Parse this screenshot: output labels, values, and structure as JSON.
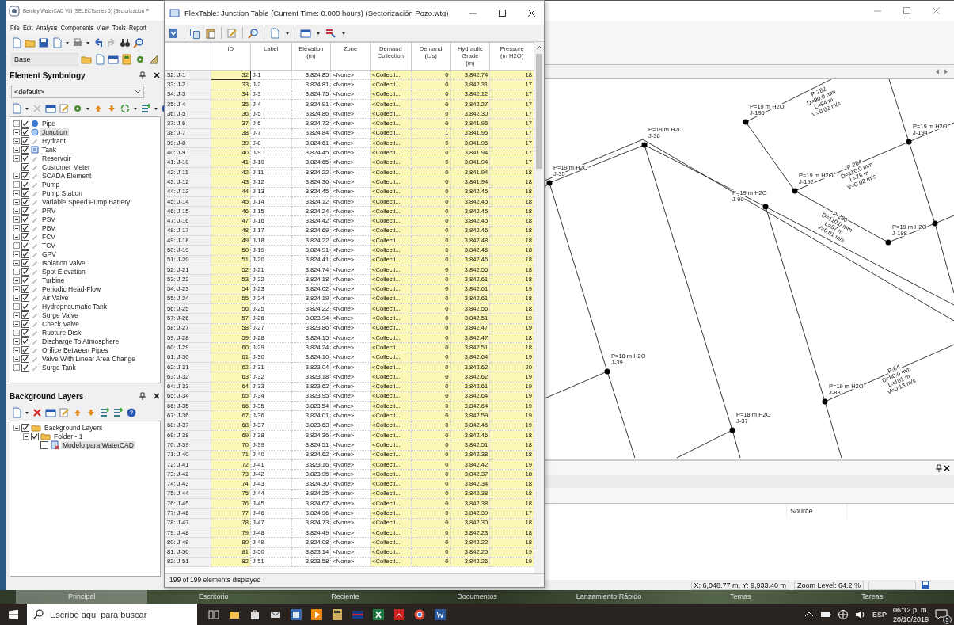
{
  "main_window": {
    "title": "Bentley WaterCAD V8i (SELECTseries 5) [Sectorización P"
  },
  "menu": [
    "File",
    "Edit",
    "Analysis",
    "Components",
    "View",
    "Tools",
    "Report"
  ],
  "scenario_dropdown": {
    "value": "Base"
  },
  "element_symbology": {
    "title": "Element Symbology",
    "dropdown": {
      "value": "<default>"
    },
    "items": [
      {
        "label": "Pipe",
        "kind": "pipe",
        "checked": true,
        "expandable": true,
        "selected": false
      },
      {
        "label": "Junction",
        "kind": "junction",
        "checked": true,
        "expandable": true,
        "selected": true
      },
      {
        "label": "Hydrant",
        "kind": "generic",
        "checked": true,
        "expandable": true,
        "selected": false
      },
      {
        "label": "Tank",
        "kind": "tank",
        "checked": true,
        "expandable": true,
        "selected": false
      },
      {
        "label": "Reservoir",
        "kind": "generic",
        "checked": true,
        "expandable": true,
        "selected": false
      },
      {
        "label": "Customer Meter",
        "kind": "generic",
        "checked": true,
        "expandable": false,
        "selected": false
      },
      {
        "label": "SCADA Element",
        "kind": "generic",
        "checked": true,
        "expandable": true,
        "selected": false
      },
      {
        "label": "Pump",
        "kind": "generic",
        "checked": true,
        "expandable": true,
        "selected": false
      },
      {
        "label": "Pump Station",
        "kind": "generic",
        "checked": true,
        "expandable": true,
        "selected": false
      },
      {
        "label": "Variable Speed Pump Battery",
        "kind": "generic",
        "checked": true,
        "expandable": true,
        "selected": false
      },
      {
        "label": "PRV",
        "kind": "generic",
        "checked": true,
        "expandable": true,
        "selected": false
      },
      {
        "label": "PSV",
        "kind": "generic",
        "checked": true,
        "expandable": true,
        "selected": false
      },
      {
        "label": "PBV",
        "kind": "generic",
        "checked": true,
        "expandable": true,
        "selected": false
      },
      {
        "label": "FCV",
        "kind": "generic",
        "checked": true,
        "expandable": true,
        "selected": false
      },
      {
        "label": "TCV",
        "kind": "generic",
        "checked": true,
        "expandable": true,
        "selected": false
      },
      {
        "label": "GPV",
        "kind": "generic",
        "checked": true,
        "expandable": true,
        "selected": false
      },
      {
        "label": "Isolation Valve",
        "kind": "generic",
        "checked": true,
        "expandable": true,
        "selected": false
      },
      {
        "label": "Spot Elevation",
        "kind": "generic",
        "checked": true,
        "expandable": true,
        "selected": false
      },
      {
        "label": "Turbine",
        "kind": "generic",
        "checked": true,
        "expandable": true,
        "selected": false
      },
      {
        "label": "Periodic Head-Flow",
        "kind": "generic",
        "checked": true,
        "expandable": true,
        "selected": false
      },
      {
        "label": "Air Valve",
        "kind": "generic",
        "checked": true,
        "expandable": true,
        "selected": false
      },
      {
        "label": "Hydropneumatic Tank",
        "kind": "generic",
        "checked": true,
        "expandable": true,
        "selected": false
      },
      {
        "label": "Surge Valve",
        "kind": "generic",
        "checked": true,
        "expandable": true,
        "selected": false
      },
      {
        "label": "Check Valve",
        "kind": "generic",
        "checked": true,
        "expandable": true,
        "selected": false
      },
      {
        "label": "Rupture Disk",
        "kind": "generic",
        "checked": true,
        "expandable": true,
        "selected": false
      },
      {
        "label": "Discharge To Atmosphere",
        "kind": "generic",
        "checked": true,
        "expandable": true,
        "selected": false
      },
      {
        "label": "Orifice Between Pipes",
        "kind": "generic",
        "checked": true,
        "expandable": true,
        "selected": false
      },
      {
        "label": "Valve With Linear Area Change",
        "kind": "generic",
        "checked": true,
        "expandable": true,
        "selected": false
      },
      {
        "label": "Surge Tank",
        "kind": "generic",
        "checked": true,
        "expandable": true,
        "selected": false
      }
    ]
  },
  "background_layers": {
    "title": "Background Layers",
    "tree": [
      {
        "label": "Background Layers",
        "kind": "folder",
        "checked": true,
        "selected": false,
        "children": [
          {
            "label": "Folder - 1",
            "kind": "folder",
            "checked": true,
            "selected": false,
            "children": [
              {
                "label": "Modelo para WaterCAD",
                "kind": "file",
                "checked": false,
                "selected": true
              }
            ]
          }
        ]
      }
    ]
  },
  "flextable": {
    "title": "FlexTable: Junction Table (Current Time:  0.000 hours) (Sectorización Pozo.wtg)",
    "columns": [
      {
        "label": "ID",
        "readonly": true
      },
      {
        "label": "Label",
        "readonly": false
      },
      {
        "label": "Elevation\n(m)",
        "readonly": false
      },
      {
        "label": "Zone",
        "readonly": false
      },
      {
        "label": "Demand\nCollection",
        "readonly": true
      },
      {
        "label": "Demand\n(L/s)",
        "readonly": true
      },
      {
        "label": "Hydraulic\nGrade\n(m)",
        "readonly": true
      },
      {
        "label": "Pressure\n(m H2O)",
        "readonly": true
      }
    ],
    "rows": [
      {
        "name": "32: J-1",
        "selected": true,
        "cells": [
          "32",
          "J-1",
          "3,824.85",
          "<None>",
          "<Collecti...",
          "0",
          "3,842.74",
          "18"
        ]
      },
      {
        "name": "33: J-2",
        "selected": false,
        "cells": [
          "33",
          "J-2",
          "3,824.81",
          "<None>",
          "<Collecti...",
          "0",
          "3,842.31",
          "17"
        ]
      },
      {
        "name": "34: J-3",
        "selected": false,
        "cells": [
          "34",
          "J-3",
          "3,824.75",
          "<None>",
          "<Collecti...",
          "0",
          "3,842.12",
          "17"
        ]
      },
      {
        "name": "35: J-4",
        "selected": false,
        "cells": [
          "35",
          "J-4",
          "3,824.91",
          "<None>",
          "<Collecti...",
          "0",
          "3,842.27",
          "17"
        ]
      },
      {
        "name": "36: J-5",
        "selected": false,
        "cells": [
          "36",
          "J-5",
          "3,824.86",
          "<None>",
          "<Collecti...",
          "0",
          "3,842.30",
          "17"
        ]
      },
      {
        "name": "37: J-6",
        "selected": false,
        "cells": [
          "37",
          "J-6",
          "3,824.72",
          "<None>",
          "<Collecti...",
          "0",
          "3,841.95",
          "17"
        ]
      },
      {
        "name": "38: J-7",
        "selected": false,
        "cells": [
          "38",
          "J-7",
          "3,824.84",
          "<None>",
          "<Collecti...",
          "1",
          "3,841.95",
          "17"
        ]
      },
      {
        "name": "39: J-8",
        "selected": false,
        "cells": [
          "39",
          "J-8",
          "3,824.61",
          "<None>",
          "<Collecti...",
          "0",
          "3,841.96",
          "17"
        ]
      },
      {
        "name": "40: J-9",
        "selected": false,
        "cells": [
          "40",
          "J-9",
          "3,824.45",
          "<None>",
          "<Collecti...",
          "0",
          "3,841.94",
          "17"
        ]
      },
      {
        "name": "41: J-10",
        "selected": false,
        "cells": [
          "41",
          "J-10",
          "3,824.65",
          "<None>",
          "<Collecti...",
          "0",
          "3,841.94",
          "17"
        ]
      },
      {
        "name": "42: J-11",
        "selected": false,
        "cells": [
          "42",
          "J-11",
          "3,824.22",
          "<None>",
          "<Collecti...",
          "0",
          "3,841.94",
          "18"
        ]
      },
      {
        "name": "43: J-12",
        "selected": false,
        "cells": [
          "43",
          "J-12",
          "3,824.36",
          "<None>",
          "<Collecti...",
          "0",
          "3,841.94",
          "18"
        ]
      },
      {
        "name": "44: J-13",
        "selected": false,
        "cells": [
          "44",
          "J-13",
          "3,824.45",
          "<None>",
          "<Collecti...",
          "0",
          "3,842.45",
          "18"
        ]
      },
      {
        "name": "45: J-14",
        "selected": false,
        "cells": [
          "45",
          "J-14",
          "3,824.12",
          "<None>",
          "<Collecti...",
          "0",
          "3,842.45",
          "18"
        ]
      },
      {
        "name": "46: J-15",
        "selected": false,
        "cells": [
          "46",
          "J-15",
          "3,824.24",
          "<None>",
          "<Collecti...",
          "0",
          "3,842.45",
          "18"
        ]
      },
      {
        "name": "47: J-16",
        "selected": false,
        "cells": [
          "47",
          "J-16",
          "3,824.42",
          "<None>",
          "<Collecti...",
          "0",
          "3,842.45",
          "18"
        ]
      },
      {
        "name": "48: J-17",
        "selected": false,
        "cells": [
          "48",
          "J-17",
          "3,824.69",
          "<None>",
          "<Collecti...",
          "0",
          "3,842.46",
          "18"
        ]
      },
      {
        "name": "49: J-18",
        "selected": false,
        "cells": [
          "49",
          "J-18",
          "3,824.22",
          "<None>",
          "<Collecti...",
          "0",
          "3,842.48",
          "18"
        ]
      },
      {
        "name": "50: J-19",
        "selected": false,
        "cells": [
          "50",
          "J-19",
          "3,824.91",
          "<None>",
          "<Collecti...",
          "0",
          "3,842.46",
          "18"
        ]
      },
      {
        "name": "51: J-20",
        "selected": false,
        "cells": [
          "51",
          "J-20",
          "3,824.41",
          "<None>",
          "<Collecti...",
          "0",
          "3,842.46",
          "18"
        ]
      },
      {
        "name": "52: J-21",
        "selected": false,
        "cells": [
          "52",
          "J-21",
          "3,824.74",
          "<None>",
          "<Collecti...",
          "0",
          "3,842.56",
          "18"
        ]
      },
      {
        "name": "53: J-22",
        "selected": false,
        "cells": [
          "53",
          "J-22",
          "3,824.18",
          "<None>",
          "<Collecti...",
          "0",
          "3,842.61",
          "18"
        ]
      },
      {
        "name": "54: J-23",
        "selected": false,
        "cells": [
          "54",
          "J-23",
          "3,824.02",
          "<None>",
          "<Collecti...",
          "0",
          "3,842.61",
          "19"
        ]
      },
      {
        "name": "55: J-24",
        "selected": false,
        "cells": [
          "55",
          "J-24",
          "3,824.19",
          "<None>",
          "<Collecti...",
          "0",
          "3,842.61",
          "18"
        ]
      },
      {
        "name": "56: J-25",
        "selected": false,
        "cells": [
          "56",
          "J-25",
          "3,824.22",
          "<None>",
          "<Collecti...",
          "0",
          "3,842.56",
          "18"
        ]
      },
      {
        "name": "57: J-26",
        "selected": false,
        "cells": [
          "57",
          "J-26",
          "3,823.94",
          "<None>",
          "<Collecti...",
          "0",
          "3,842.51",
          "19"
        ]
      },
      {
        "name": "58: J-27",
        "selected": false,
        "cells": [
          "58",
          "J-27",
          "3,823.86",
          "<None>",
          "<Collecti...",
          "0",
          "3,842.47",
          "19"
        ]
      },
      {
        "name": "59: J-28",
        "selected": false,
        "cells": [
          "59",
          "J-28",
          "3,824.15",
          "<None>",
          "<Collecti...",
          "0",
          "3,842.47",
          "18"
        ]
      },
      {
        "name": "60: J-29",
        "selected": false,
        "cells": [
          "60",
          "J-29",
          "3,824.24",
          "<None>",
          "<Collecti...",
          "0",
          "3,842.51",
          "18"
        ]
      },
      {
        "name": "61: J-30",
        "selected": false,
        "cells": [
          "61",
          "J-30",
          "3,824.10",
          "<None>",
          "<Collecti...",
          "0",
          "3,842.64",
          "19"
        ]
      },
      {
        "name": "62: J-31",
        "selected": false,
        "cells": [
          "62",
          "J-31",
          "3,823.04",
          "<None>",
          "<Collecti...",
          "0",
          "3,842.62",
          "20"
        ]
      },
      {
        "name": "63: J-32",
        "selected": false,
        "cells": [
          "63",
          "J-32",
          "3,823.18",
          "<None>",
          "<Collecti...",
          "0",
          "3,842.62",
          "19"
        ]
      },
      {
        "name": "64: J-33",
        "selected": false,
        "cells": [
          "64",
          "J-33",
          "3,823.62",
          "<None>",
          "<Collecti...",
          "0",
          "3,842.61",
          "19"
        ]
      },
      {
        "name": "65: J-34",
        "selected": false,
        "cells": [
          "65",
          "J-34",
          "3,823.95",
          "<None>",
          "<Collecti...",
          "0",
          "3,842.64",
          "19"
        ]
      },
      {
        "name": "66: J-35",
        "selected": false,
        "cells": [
          "66",
          "J-35",
          "3,823.54",
          "<None>",
          "<Collecti...",
          "0",
          "3,842.64",
          "19"
        ]
      },
      {
        "name": "67: J-36",
        "selected": false,
        "cells": [
          "67",
          "J-36",
          "3,824.01",
          "<None>",
          "<Collecti...",
          "0",
          "3,842.59",
          "19"
        ]
      },
      {
        "name": "68: J-37",
        "selected": false,
        "cells": [
          "68",
          "J-37",
          "3,823.63",
          "<None>",
          "<Collecti...",
          "0",
          "3,842.45",
          "19"
        ]
      },
      {
        "name": "69: J-38",
        "selected": false,
        "cells": [
          "69",
          "J-38",
          "3,824.36",
          "<None>",
          "<Collecti...",
          "0",
          "3,842.46",
          "18"
        ]
      },
      {
        "name": "70: J-39",
        "selected": false,
        "cells": [
          "70",
          "J-39",
          "3,824.51",
          "<None>",
          "<Collecti...",
          "0",
          "3,842.51",
          "18"
        ]
      },
      {
        "name": "71: J-40",
        "selected": false,
        "cells": [
          "71",
          "J-40",
          "3,824.62",
          "<None>",
          "<Collecti...",
          "0",
          "3,842.38",
          "18"
        ]
      },
      {
        "name": "72: J-41",
        "selected": false,
        "cells": [
          "72",
          "J-41",
          "3,823.16",
          "<None>",
          "<Collecti...",
          "0",
          "3,842.42",
          "19"
        ]
      },
      {
        "name": "73: J-42",
        "selected": false,
        "cells": [
          "73",
          "J-42",
          "3,823.95",
          "<None>",
          "<Collecti...",
          "0",
          "3,842.37",
          "18"
        ]
      },
      {
        "name": "74: J-43",
        "selected": false,
        "cells": [
          "74",
          "J-43",
          "3,824.30",
          "<None>",
          "<Collecti...",
          "0",
          "3,842.34",
          "18"
        ]
      },
      {
        "name": "75: J-44",
        "selected": false,
        "cells": [
          "75",
          "J-44",
          "3,824.25",
          "<None>",
          "<Collecti...",
          "0",
          "3,842.38",
          "18"
        ]
      },
      {
        "name": "76: J-45",
        "selected": false,
        "cells": [
          "76",
          "J-45",
          "3,824.67",
          "<None>",
          "<Collecti...",
          "0",
          "3,842.38",
          "18"
        ]
      },
      {
        "name": "77: J-46",
        "selected": false,
        "cells": [
          "77",
          "J-46",
          "3,824.96",
          "<None>",
          "<Collecti...",
          "0",
          "3,842.39",
          "17"
        ]
      },
      {
        "name": "78: J-47",
        "selected": false,
        "cells": [
          "78",
          "J-47",
          "3,824.73",
          "<None>",
          "<Collecti...",
          "0",
          "3,842.30",
          "18"
        ]
      },
      {
        "name": "79: J-48",
        "selected": false,
        "cells": [
          "79",
          "J-48",
          "3,824.49",
          "<None>",
          "<Collecti...",
          "0",
          "3,842.23",
          "18"
        ]
      },
      {
        "name": "80: J-49",
        "selected": false,
        "cells": [
          "80",
          "J-49",
          "3,824.08",
          "<None>",
          "<Collecti...",
          "0",
          "3,842.22",
          "18"
        ]
      },
      {
        "name": "81: J-50",
        "selected": false,
        "cells": [
          "81",
          "J-50",
          "3,823.14",
          "<None>",
          "<Collecti...",
          "0",
          "3,842.25",
          "19"
        ]
      },
      {
        "name": "82: J-51",
        "selected": false,
        "cells": [
          "82",
          "J-51",
          "3,823.58",
          "<None>",
          "<Collecti...",
          "0",
          "3,842.26",
          "19"
        ]
      }
    ],
    "footer": "199 of 199 elements displayed"
  },
  "map": {
    "nodes": [
      {
        "label": "J-35",
        "pressure": "P=19 m H2O"
      },
      {
        "label": "J-36",
        "pressure": "P=19 m H2O"
      },
      {
        "label": "J-196",
        "pressure": "P=19 m H2O"
      },
      {
        "label": "J-194",
        "pressure": "P=19 m H2O"
      },
      {
        "label": "J-192",
        "pressure": "P=19 m H2O"
      },
      {
        "label": "J-90",
        "pressure": "P=19 m H2O"
      },
      {
        "label": "J-198",
        "pressure": "P=19 m H2O"
      },
      {
        "label": "J-39",
        "pressure": "P=18 m H2O"
      },
      {
        "label": "J-37",
        "pressure": "P=18 m H2O"
      },
      {
        "label": "J-88",
        "pressure": "P=19 m H2O"
      }
    ],
    "pipes": [
      {
        "label": "P-282",
        "lines": [
          "D=90.0 mm",
          "L=94 m",
          "V=0.02 m/s"
        ]
      },
      {
        "label": "P-284",
        "lines": [
          "D=110.0 mm",
          "L=78 m",
          "V=0.02 m/s"
        ]
      },
      {
        "label": "P-280",
        "lines": [
          "D=110.0 mm",
          "L=67 m",
          "V=0.01 m/s"
        ]
      },
      {
        "label": "P-64",
        "lines": [
          "D=80.0 mm",
          "L=101 m",
          "V=0.13 m/s"
        ]
      }
    ]
  },
  "bottom_panel": {
    "columns": [
      "Source"
    ]
  },
  "status_bar": {
    "coordinates": "X: 6,048.77 m, Y: 9,933.40 m",
    "zoom": "Zoom Level: 64.2 %"
  },
  "launcher": [
    {
      "label": "Principal",
      "selected": true
    },
    {
      "label": "Escritorio",
      "selected": false
    },
    {
      "label": "Reciente",
      "selected": false
    },
    {
      "label": "Documentos",
      "selected": false
    },
    {
      "label": "Lanzamiento Rápido",
      "selected": false
    },
    {
      "label": "Temas",
      "selected": false
    },
    {
      "label": "Tareas",
      "selected": false
    }
  ],
  "taskbar": {
    "search_placeholder": "Escribe aquí para buscar",
    "language": "ESP",
    "time": "06:12 p. m.",
    "date": "20/10/2019",
    "notifications": "5"
  }
}
